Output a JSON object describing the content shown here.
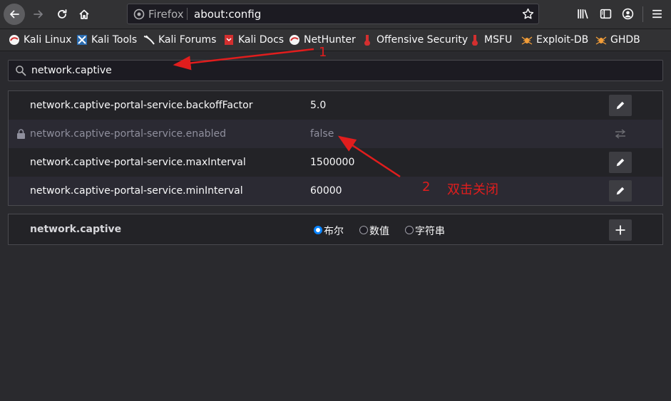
{
  "browser": {
    "identity_label": "Firefox",
    "url": "about:config"
  },
  "bookmarks": [
    {
      "label": "Kali Linux",
      "icon": "kali-icon"
    },
    {
      "label": "Kali Tools",
      "icon": "kali-tools-icon"
    },
    {
      "label": "Kali Forums",
      "icon": "kali-dragon-icon"
    },
    {
      "label": "Kali Docs",
      "icon": "kali-docs-icon"
    },
    {
      "label": "NetHunter",
      "icon": "kali-icon"
    },
    {
      "label": "Offensive Security",
      "icon": "offsec-icon"
    },
    {
      "label": "MSFU",
      "icon": "offsec-icon"
    },
    {
      "label": "Exploit-DB",
      "icon": "spider-icon"
    },
    {
      "label": "GHDB",
      "icon": "spider-icon"
    }
  ],
  "search": {
    "value": "network.captive"
  },
  "prefs": [
    {
      "name": "network.captive-portal-service.backoffFactor",
      "value": "5.0",
      "locked": false,
      "action": "edit"
    },
    {
      "name": "network.captive-portal-service.enabled",
      "value": "false",
      "locked": true,
      "action": "toggle"
    },
    {
      "name": "network.captive-portal-service.maxInterval",
      "value": "1500000",
      "locked": false,
      "action": "edit"
    },
    {
      "name": "network.captive-portal-service.minInterval",
      "value": "60000",
      "locked": false,
      "action": "edit"
    }
  ],
  "new_pref": {
    "name": "network.captive",
    "types": [
      {
        "label": "布尔",
        "checked": true
      },
      {
        "label": "数值",
        "checked": false
      },
      {
        "label": "字符串",
        "checked": false
      }
    ]
  },
  "annotations": [
    {
      "label": "1"
    },
    {
      "label": "2"
    },
    {
      "label": "双击关闭"
    }
  ],
  "colors": {
    "accent": "#0a84ff",
    "annotation": "#e11d1d"
  }
}
